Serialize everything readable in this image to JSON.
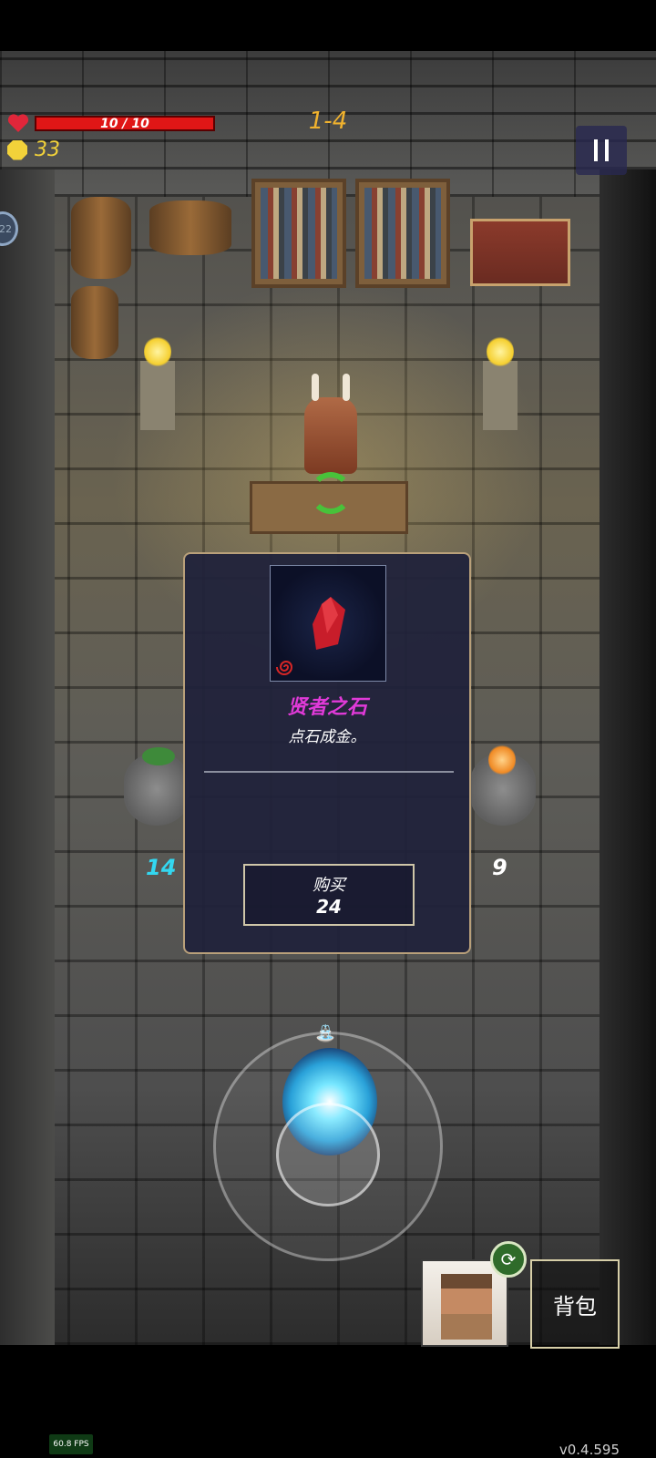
{
  "hud": {
    "hp_text": "10 / 10",
    "hp_fraction": 1.0,
    "gold": "33",
    "level": "1-4",
    "side_badge": "22"
  },
  "shop": {
    "left_price": "14",
    "right_price": "9"
  },
  "popup": {
    "item_name": "贤者之石",
    "item_desc": "点石成金。",
    "buy_label": "购买",
    "buy_price": "24"
  },
  "bottom": {
    "bag_label": "背包"
  },
  "footer": {
    "fps": "60.8 FPS",
    "version": "v0.4.595"
  },
  "colors": {
    "hp": "#e01616",
    "gold": "#f2d23a",
    "level": "#f0b22e",
    "item_name": "#e03ad8",
    "left_price": "#33d7f0"
  },
  "icons": [
    "heart-icon",
    "gold-coin-icon",
    "pause-icon",
    "refresh-icon",
    "swirl-icon",
    "fountain-icon"
  ]
}
